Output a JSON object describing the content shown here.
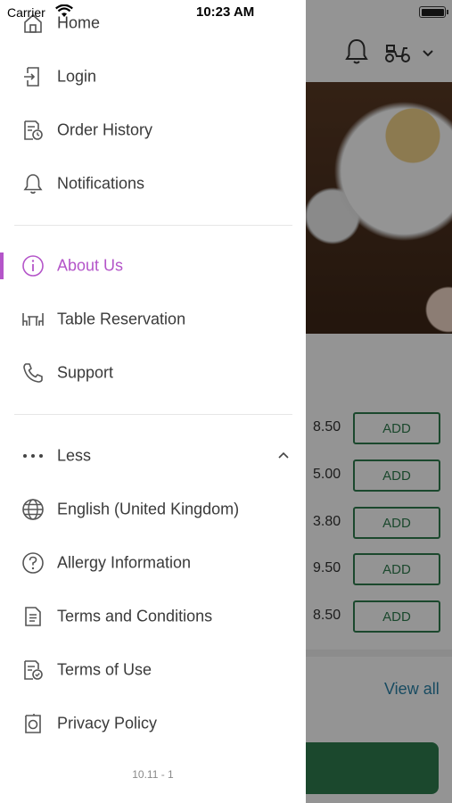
{
  "status_bar": {
    "carrier": "Carrier",
    "time": "10:23 AM"
  },
  "drawer": {
    "items_top": [
      {
        "label": "Home",
        "icon": "home-icon"
      },
      {
        "label": "Login",
        "icon": "login-icon"
      },
      {
        "label": "Order History",
        "icon": "order-history-icon"
      },
      {
        "label": "Notifications",
        "icon": "bell-icon"
      }
    ],
    "items_mid": [
      {
        "label": "About Us",
        "icon": "info-icon",
        "active": true
      },
      {
        "label": "Table Reservation",
        "icon": "table-icon"
      },
      {
        "label": "Support",
        "icon": "phone-icon"
      }
    ],
    "less_label": "Less",
    "items_bottom": [
      {
        "label": "English (United Kingdom)",
        "icon": "globe-icon"
      },
      {
        "label": "Allergy Information",
        "icon": "question-icon"
      },
      {
        "label": "Terms and Conditions",
        "icon": "document-icon"
      },
      {
        "label": "Terms of Use",
        "icon": "document-check-icon"
      },
      {
        "label": "Privacy Policy",
        "icon": "privacy-icon"
      }
    ],
    "version": "10.11 - 1",
    "active_color": "#b455c9"
  },
  "background": {
    "prices": [
      "8.50",
      "5.00",
      "3.80",
      "9.50",
      "8.50"
    ],
    "add_label": "ADD",
    "view_all": "View all",
    "accent_green": "#2f7d4f",
    "link_blue": "#2a82a8"
  }
}
